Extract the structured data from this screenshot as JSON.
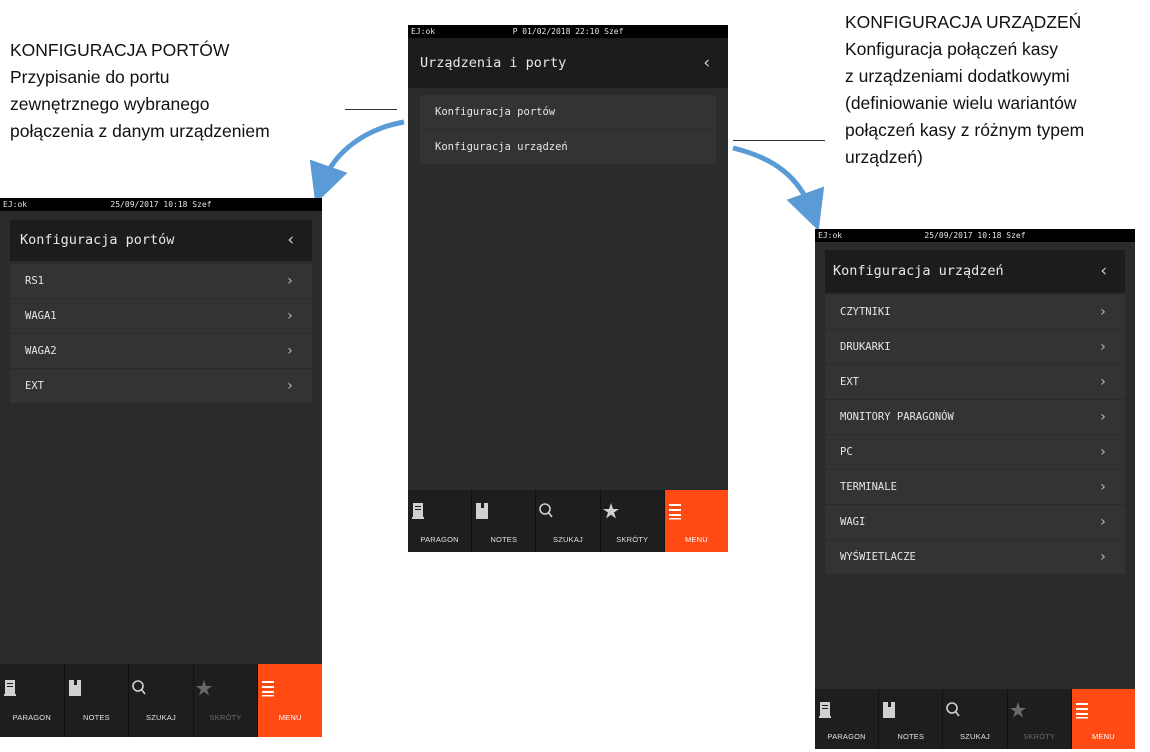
{
  "annotations": {
    "left": {
      "lines": [
        "KONFIGURACJA PORTÓW",
        "Przypisanie do portu",
        "zewnętrznego wybranego",
        "połączenia z danym urządzeniem"
      ]
    },
    "right": {
      "lines": [
        "KONFIGURACJA URZĄDZEŃ",
        "Konfiguracja połączeń kasy",
        "z urządzeniami dodatkowymi",
        "(definiowanie wielu wariantów",
        "połączeń kasy z różnym typem",
        "urządzeń)"
      ]
    }
  },
  "center_screen": {
    "status": {
      "ej": "EJ:ok",
      "datetime": "P 01/02/2018 22:10 Szef"
    },
    "header": {
      "title": "Urządzenia i porty",
      "back": "‹"
    },
    "items": [
      {
        "label": "Konfiguracja portów"
      },
      {
        "label": "Konfiguracja urządzeń"
      }
    ],
    "tabs": [
      {
        "label": "PARAGON",
        "icon": "receipt-icon",
        "state": "normal"
      },
      {
        "label": "NOTES",
        "icon": "notebook-icon",
        "state": "normal"
      },
      {
        "label": "SZUKAJ",
        "icon": "search-icon",
        "state": "normal"
      },
      {
        "label": "SKRÓTY",
        "icon": "star-icon",
        "state": "normal"
      },
      {
        "label": "MENU",
        "icon": "menu-icon",
        "state": "active"
      }
    ]
  },
  "left_screen": {
    "status": {
      "ej": "EJ:ok",
      "datetime": "25/09/2017 10:18 Szef"
    },
    "header": {
      "title": "Konfiguracja portów",
      "back": "‹"
    },
    "items": [
      {
        "label": "RS1",
        "chevron": "›"
      },
      {
        "label": "WAGA1",
        "chevron": "›"
      },
      {
        "label": "WAGA2",
        "chevron": "›"
      },
      {
        "label": "EXT",
        "chevron": "›"
      }
    ],
    "tabs": [
      {
        "label": "PARAGON",
        "icon": "receipt-icon",
        "state": "normal"
      },
      {
        "label": "NOTES",
        "icon": "notebook-icon",
        "state": "normal"
      },
      {
        "label": "SZUKAJ",
        "icon": "search-icon",
        "state": "normal"
      },
      {
        "label": "SKRÓTY",
        "icon": "star-icon",
        "state": "disabled"
      },
      {
        "label": "MENU",
        "icon": "menu-icon",
        "state": "active"
      }
    ]
  },
  "right_screen": {
    "status": {
      "ej": "EJ:ok",
      "datetime": "25/09/2017 10:18 Szef"
    },
    "header": {
      "title": "Konfiguracja urządzeń",
      "back": "‹"
    },
    "items": [
      {
        "label": "CZYTNIKI",
        "chevron": "›"
      },
      {
        "label": "DRUKARKI",
        "chevron": "›"
      },
      {
        "label": "EXT",
        "chevron": "›"
      },
      {
        "label": "MONITORY PARAGONÓW",
        "chevron": "›"
      },
      {
        "label": "PC",
        "chevron": "›"
      },
      {
        "label": "TERMINALE",
        "chevron": "›"
      },
      {
        "label": "WAGI",
        "chevron": "›"
      },
      {
        "label": "WYŚWIETLACZE",
        "chevron": "›"
      }
    ],
    "tabs": [
      {
        "label": "PARAGON",
        "icon": "receipt-icon",
        "state": "normal"
      },
      {
        "label": "NOTES",
        "icon": "notebook-icon",
        "state": "normal"
      },
      {
        "label": "SZUKAJ",
        "icon": "search-icon",
        "state": "normal"
      },
      {
        "label": "SKRÓTY",
        "icon": "star-icon",
        "state": "disabled"
      },
      {
        "label": "MENU",
        "icon": "menu-icon",
        "state": "active"
      }
    ]
  },
  "colors": {
    "accent": "#ff4a14",
    "arrow": "#5b9bd5",
    "screen_bg": "#2b2b2b",
    "row_bg": "#333333"
  }
}
